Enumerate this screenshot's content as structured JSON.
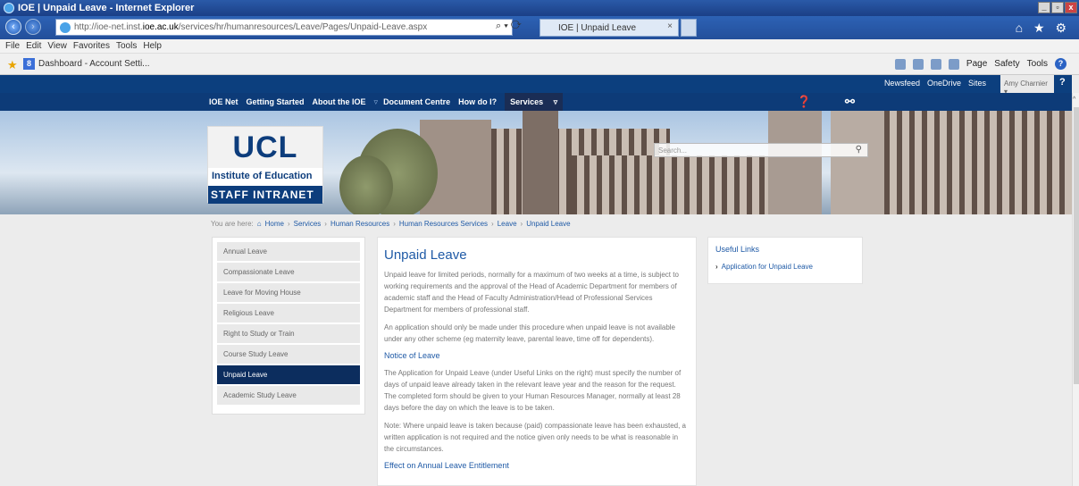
{
  "window": {
    "title": "IOE | Unpaid Leave - Internet Explorer"
  },
  "browser": {
    "url_prefix": "http://ioe-net.inst.",
    "url_domain": "ioe.ac.uk",
    "url_path": "/services/hr/humanresources/Leave/Pages/Unpaid-Leave.aspx",
    "tab_title": "IOE | Unpaid Leave",
    "menu": [
      "File",
      "Edit",
      "View",
      "Favorites",
      "Tools",
      "Help"
    ],
    "favorite": "Dashboard - Account Setti...",
    "commands": [
      "Page",
      "Safety",
      "Tools"
    ]
  },
  "suitebar": {
    "links": [
      "Newsfeed",
      "OneDrive",
      "Sites"
    ],
    "user": "Amy Charnier",
    "help": "?"
  },
  "globalnav": {
    "items": [
      "IOE Net",
      "Getting Started",
      "About the IOE",
      "Document Centre",
      "How do I?"
    ],
    "active": "Services"
  },
  "banner": {
    "logo_top": "UCL",
    "logo_sub": "Institute of Education",
    "tagline": "STAFF INTRANET",
    "search_placeholder": "Search..."
  },
  "breadcrumb": {
    "prefix": "You are here:",
    "items": [
      "Home",
      "Services",
      "Human Resources",
      "Human Resources Services",
      "Leave",
      "Unpaid Leave"
    ]
  },
  "leftnav": {
    "items": [
      "Annual Leave",
      "Compassionate Leave",
      "Leave for Moving House",
      "Religious Leave",
      "Right to Study or Train",
      "Course Study Leave",
      "Unpaid Leave",
      "Academic Study Leave"
    ],
    "active_index": 6
  },
  "main": {
    "title": "Unpaid Leave",
    "p1": "Unpaid leave for limited periods, normally for a maximum of two weeks at a time, is subject to working requirements and the approval of the Head of Academic Department for members of academic staff and the Head of Faculty Administration/Head of Professional Services Department for members of professional staff.",
    "p2": "An application should only be made under this procedure when unpaid leave is not available under any other scheme (eg maternity leave, parental leave, time off for dependents).",
    "h2": "Notice of Leave",
    "p3": "The Application for Unpaid Leave (under Useful Links on the right) must specify the number of days of unpaid leave already taken in the relevant leave year and the reason for the request.  The completed form should be given to your Human Resources Manager, normally at least 28 days before the day on which the leave is to be taken.",
    "p4": "Note: Where unpaid leave is taken because (paid) compassionate leave has been exhausted, a written application is not required and the notice given only needs to be what is reasonable in the circumstances.",
    "h3": "Effect on Annual Leave Entitlement"
  },
  "useful_links": {
    "title": "Useful Links",
    "link": "Application for Unpaid Leave"
  }
}
